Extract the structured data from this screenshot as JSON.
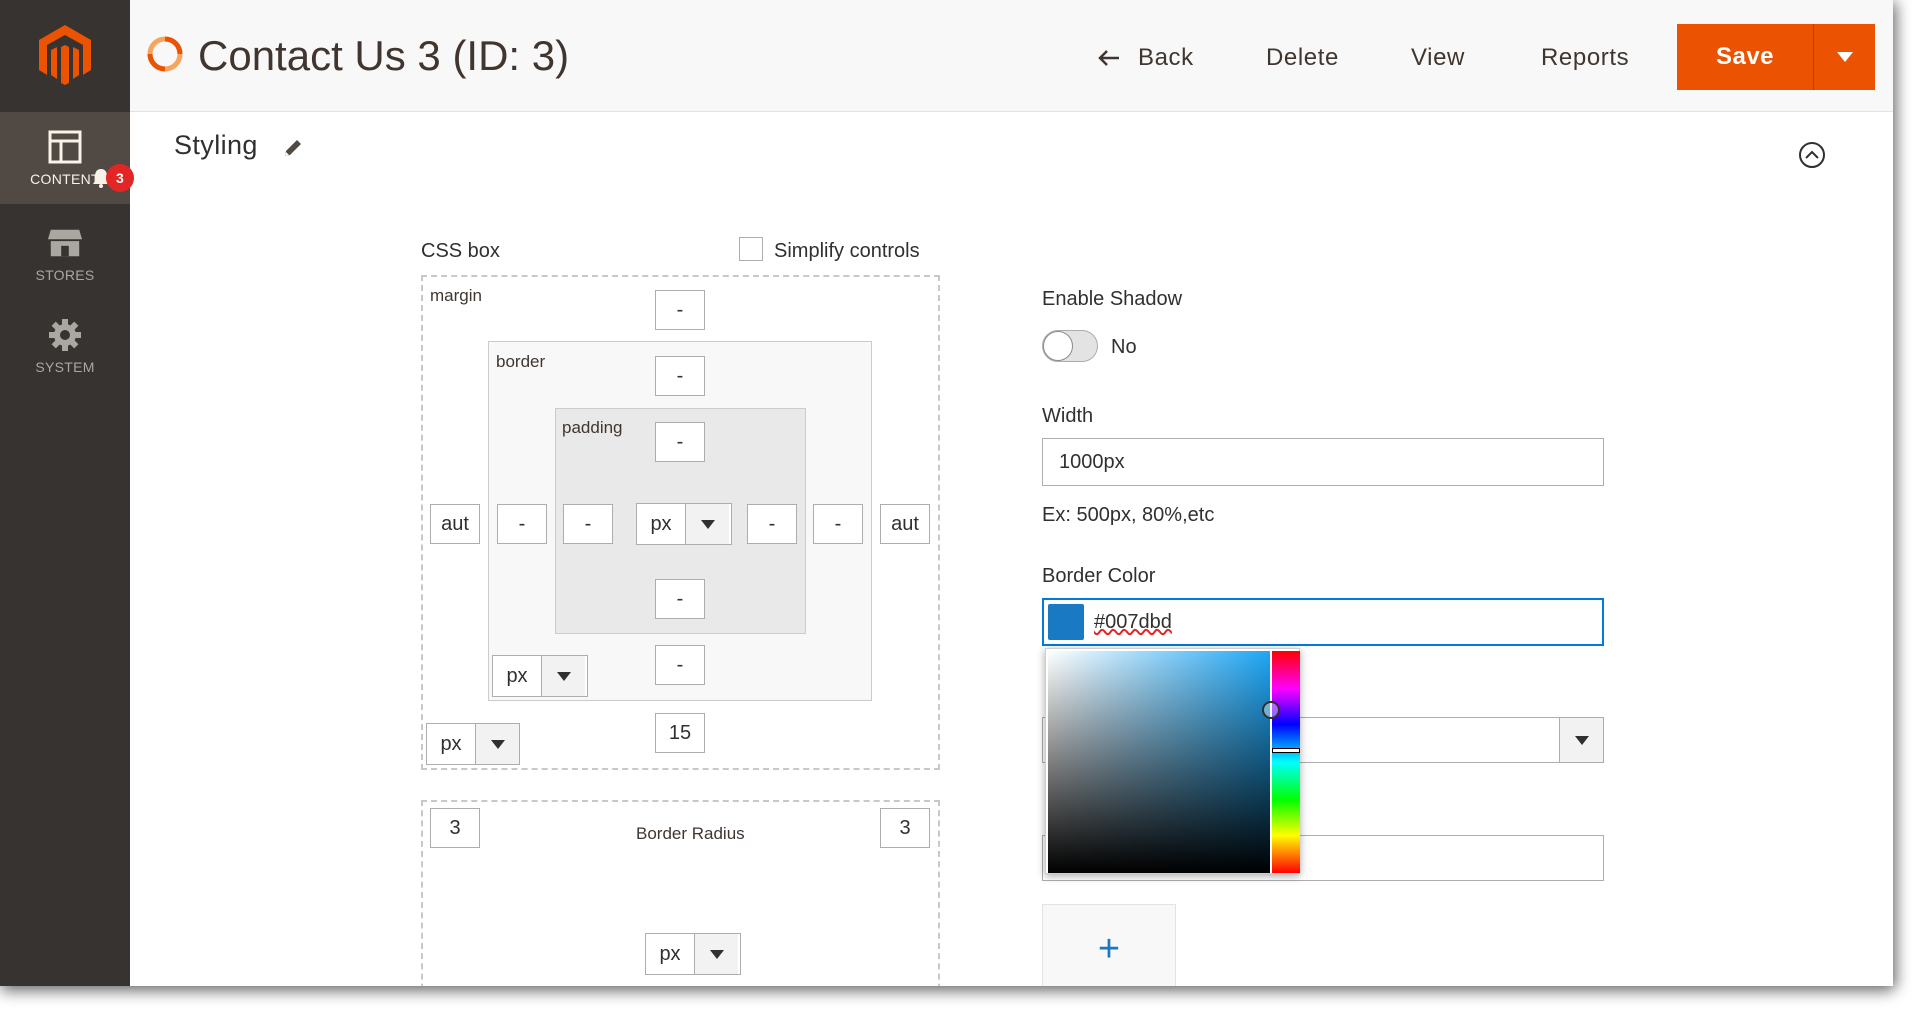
{
  "sidebar": {
    "items": [
      {
        "label": "CONTENT",
        "icon": "content-icon",
        "active": true,
        "notifications": "3"
      },
      {
        "label": "STORES",
        "icon": "stores-icon",
        "active": false
      },
      {
        "label": "SYSTEM",
        "icon": "gear-icon",
        "active": false
      }
    ]
  },
  "header": {
    "title": "Contact Us 3 (ID: 3)",
    "back_label": "Back",
    "delete_label": "Delete",
    "view_label": "View",
    "reports_label": "Reports",
    "save_label": "Save"
  },
  "section": {
    "title": "Styling"
  },
  "css_box": {
    "label": "CSS box",
    "simplify_label": "Simplify controls",
    "simplify_checked": false,
    "margin_label": "margin",
    "border_label": "border",
    "padding_label": "padding",
    "margin": {
      "top": "-",
      "left": "aut",
      "right": "aut",
      "bottom": "15",
      "unit": "px"
    },
    "border": {
      "top": "-",
      "left": "-",
      "right": "-",
      "bottom": "-",
      "unit": "px"
    },
    "padding": {
      "top": "-",
      "left": "-",
      "right": "-",
      "bottom": "-",
      "unit": "px"
    },
    "radius_label": "Border Radius",
    "radius": {
      "top_left": "3",
      "top_right": "3",
      "unit": "px"
    }
  },
  "form": {
    "shadow_label": "Enable Shadow",
    "shadow_value": "No",
    "width_label": "Width",
    "width_value": "1000px",
    "width_hint": "Ex: 500px, 80%,etc",
    "border_color_label": "Border Color",
    "border_color_value": "#007dbd",
    "swatch_color": "#1979c3",
    "add_label": "+"
  },
  "colors": {
    "accent": "#eb5202",
    "sidebar_bg": "#373330",
    "focus": "#007bdb"
  }
}
